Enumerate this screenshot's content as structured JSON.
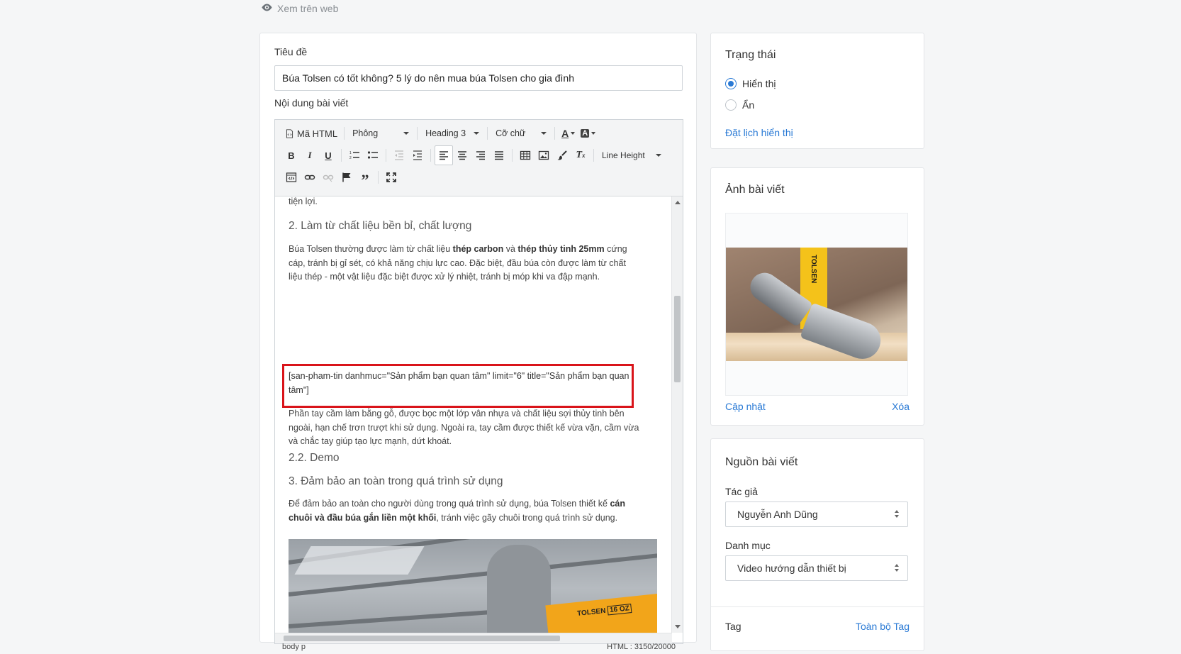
{
  "top": {
    "view_web": "Xem trên web"
  },
  "main": {
    "title_label": "Tiêu đề",
    "title_value": "Búa Tolsen có tốt không? 5 lý do nên mua búa Tolsen cho gia đình",
    "content_label": "Nội dung bài viết"
  },
  "toolbar": {
    "html_label": "Mã HTML",
    "font_label": "Phông",
    "heading_label": "Heading 3",
    "size_label": "Cỡ chữ",
    "line_height_label": "Line Height"
  },
  "content": {
    "p0": "tiện lợi.",
    "h1": "2. Làm từ chất liệu bền bỉ, chất lượng",
    "p1_a": "Búa Tolsen thường được làm từ chất liệu ",
    "p1_b": "thép carbon",
    "p1_c": " và ",
    "p1_d": "thép thủy tinh 25mm",
    "p1_e": " cứng cáp, tránh bị gỉ sét, có khả năng chịu lực cao. Đặc biệt, đầu búa còn được làm từ chất liệu thép - một vật liệu đặc biệt được xử lý nhiệt, tránh bị móp khi va đập mạnh.",
    "shortcode": "[san-pham-tin danhmuc=\"Sản phẩm bạn quan tâm\" limit=\"6\" title=\"Sản phẩm bạn quan tâm\"]",
    "p2": "Phần tay cầm làm bằng gỗ, được bọc một lớp vân nhựa và chất liệu sợi thủy tinh bên ngoài, hạn chế trơn trượt khi sử dụng. Ngoài ra, tay cầm được thiết kế vừa vặn, cầm vừa và chắc tay giúp tạo lực mạnh, dứt khoát.",
    "h2": "2.2. Demo",
    "h3": "3. Đảm bảo an toàn trong quá trình sử dụng",
    "p3_a": "Để đảm bảo an toàn cho người dùng trong quá trình sử dụng, búa Tolsen thiết kế ",
    "p3_b": "cán chuôi và đầu búa gắn liền một khối",
    "p3_c": ", tránh việc gãy chuôi trong quá trình sử dụng.",
    "photo_brand": "TOLSEN",
    "photo_weight": "16 OZ"
  },
  "statusbar": {
    "path": "body p",
    "count": "HTML : 3150/20000"
  },
  "status_card": {
    "title": "Trạng thái",
    "opt_show": "Hiển thị",
    "opt_hide": "Ẩn",
    "schedule_link": "Đặt lịch hiển thị",
    "selected": "Hiển thị"
  },
  "image_card": {
    "title": "Ảnh bài viết",
    "update_link": "Cập nhật",
    "delete_link": "Xóa",
    "brand_text": "TOLSEN"
  },
  "source_card": {
    "title": "Nguồn bài viết",
    "author_label": "Tác giả",
    "author_value": "Nguyễn Anh Dũng",
    "category_label": "Danh mục",
    "category_value": "Video hướng dẫn thiết bị",
    "tag_label": "Tag",
    "all_tags_link": "Toàn bộ Tag"
  },
  "colors": {
    "accent": "#2a7ad5",
    "highlight_border": "#d9141a"
  }
}
